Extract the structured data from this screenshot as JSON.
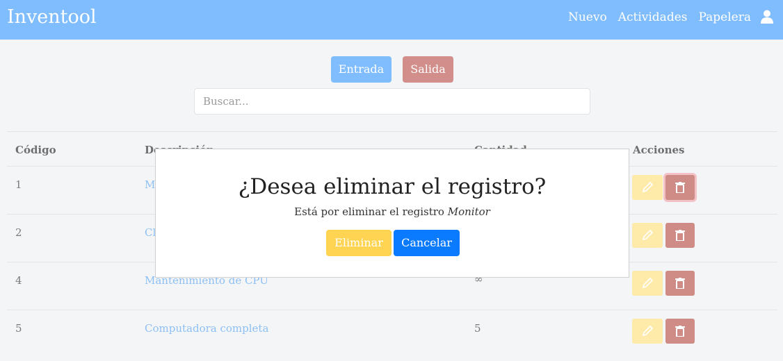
{
  "app": {
    "title": "Inventool"
  },
  "nav": {
    "items": [
      "Nuevo",
      "Actividades",
      "Papelera"
    ]
  },
  "actions": {
    "entrada": "Entrada",
    "salida": "Salida"
  },
  "search": {
    "placeholder": "Buscar..."
  },
  "table": {
    "headers": [
      "Código",
      "Descripción",
      "Cantidad",
      "Acciones"
    ],
    "rows": [
      {
        "codigo": "1",
        "descripcion": "M",
        "cantidad": ""
      },
      {
        "codigo": "2",
        "descripcion": "Cl",
        "cantidad": ""
      },
      {
        "codigo": "4",
        "descripcion": "Mantenimiento de CPU",
        "cantidad": "∞"
      },
      {
        "codigo": "5",
        "descripcion": "Computadora completa",
        "cantidad": "5"
      }
    ]
  },
  "modal": {
    "title": "¿Desea eliminar el registro?",
    "text_prefix": "Está por eliminar el registro",
    "record_name": "Monitor",
    "confirm": "Eliminar",
    "cancel": "Cancelar"
  },
  "colors": {
    "navbar": "#80bdfe",
    "entrada": "#80bdfe",
    "salida": "#d18e8a",
    "edit": "#feeaa9",
    "delete": "#cf8c87",
    "confirm": "#ffd452",
    "cancel": "#0a7bff",
    "link": "#8dbff5"
  },
  "icons": {
    "user": "user-icon",
    "edit": "pencil-icon",
    "delete": "trash-icon"
  }
}
